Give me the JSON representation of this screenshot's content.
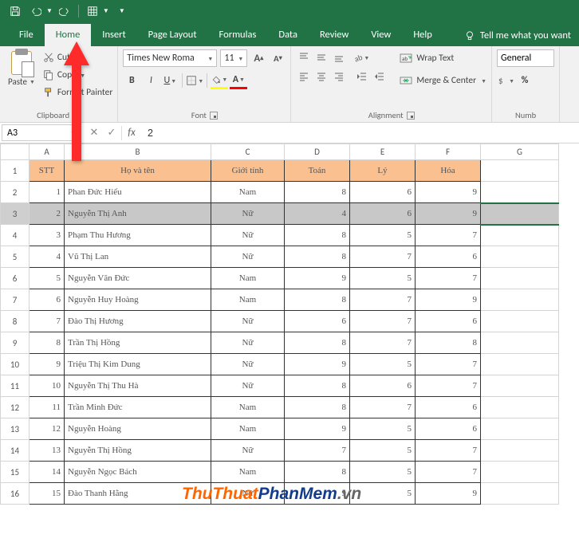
{
  "qat": {
    "save": "Save",
    "undo": "Undo",
    "redo": "Redo",
    "table": "Quick Table"
  },
  "tabs": {
    "file": "File",
    "home": "Home",
    "insert": "Insert",
    "page_layout": "Page Layout",
    "formulas": "Formulas",
    "data": "Data",
    "review": "Review",
    "view": "View",
    "help": "Help",
    "tellme": "Tell me what you want"
  },
  "ribbon": {
    "clipboard": {
      "paste": "Paste",
      "cut": "Cut",
      "copy": "Copy",
      "format_painter": "Format Painter",
      "label": "Clipboard"
    },
    "font": {
      "font_name": "Times New Roma",
      "font_size": "11",
      "increase": "A",
      "decrease": "A",
      "bold": "B",
      "italic": "I",
      "underline": "U",
      "label": "Font"
    },
    "alignment": {
      "wrap": "Wrap Text",
      "merge": "Merge & Center",
      "label": "Alignment"
    },
    "number": {
      "format": "General",
      "label": "Numb"
    }
  },
  "formula_bar": {
    "name_box": "A3",
    "formula": "2"
  },
  "grid": {
    "col_headers": [
      "A",
      "B",
      "C",
      "D",
      "E",
      "F",
      "G"
    ],
    "table_headers": [
      "STT",
      "Họ và tên",
      "Giới tính",
      "Toán",
      "Lý",
      "Hóa"
    ],
    "rows": [
      {
        "stt": "1",
        "name": "Phan Đức Hiếu",
        "gt": "Nam",
        "toan": "8",
        "ly": "6",
        "hoa": "9"
      },
      {
        "stt": "2",
        "name": "Nguyễn Thị Anh",
        "gt": "Nữ",
        "toan": "4",
        "ly": "6",
        "hoa": "9"
      },
      {
        "stt": "3",
        "name": "Phạm Thu Hương",
        "gt": "Nữ",
        "toan": "8",
        "ly": "5",
        "hoa": "7"
      },
      {
        "stt": "4",
        "name": "Vũ Thị Lan",
        "gt": "Nữ",
        "toan": "8",
        "ly": "7",
        "hoa": "6"
      },
      {
        "stt": "5",
        "name": "Nguyễn Văn Đức",
        "gt": "Nam",
        "toan": "9",
        "ly": "5",
        "hoa": "7"
      },
      {
        "stt": "6",
        "name": "Nguyễn Huy Hoàng",
        "gt": "Nam",
        "toan": "8",
        "ly": "7",
        "hoa": "9"
      },
      {
        "stt": "7",
        "name": "Đào Thị Hương",
        "gt": "Nữ",
        "toan": "6",
        "ly": "7",
        "hoa": "6"
      },
      {
        "stt": "8",
        "name": "Trần Thị Hồng",
        "gt": "Nữ",
        "toan": "8",
        "ly": "7",
        "hoa": "8"
      },
      {
        "stt": "9",
        "name": "Triệu Thị Kim Dung",
        "gt": "Nữ",
        "toan": "9",
        "ly": "5",
        "hoa": "7"
      },
      {
        "stt": "10",
        "name": "Nguyễn Thị Thu Hà",
        "gt": "Nữ",
        "toan": "8",
        "ly": "6",
        "hoa": "7"
      },
      {
        "stt": "11",
        "name": "Trần Minh Đức",
        "gt": "Nam",
        "toan": "8",
        "ly": "7",
        "hoa": "6"
      },
      {
        "stt": "12",
        "name": "Nguyễn Hoàng",
        "gt": "Nam",
        "toan": "9",
        "ly": "5",
        "hoa": "6"
      },
      {
        "stt": "13",
        "name": "Nguyễn Thị Hồng",
        "gt": "Nữ",
        "toan": "7",
        "ly": "5",
        "hoa": "7"
      },
      {
        "stt": "14",
        "name": "Nguyễn Ngọc Bách",
        "gt": "Nam",
        "toan": "8",
        "ly": "5",
        "hoa": "7"
      },
      {
        "stt": "15",
        "name": "Đào Thanh Hằng",
        "gt": "Nữ",
        "toan": "9",
        "ly": "5",
        "hoa": "9"
      }
    ],
    "selected_row_index": 1
  },
  "watermark": {
    "p1": "ThuThuat",
    "p2": "PhanMem",
    "p3": ".vn"
  }
}
